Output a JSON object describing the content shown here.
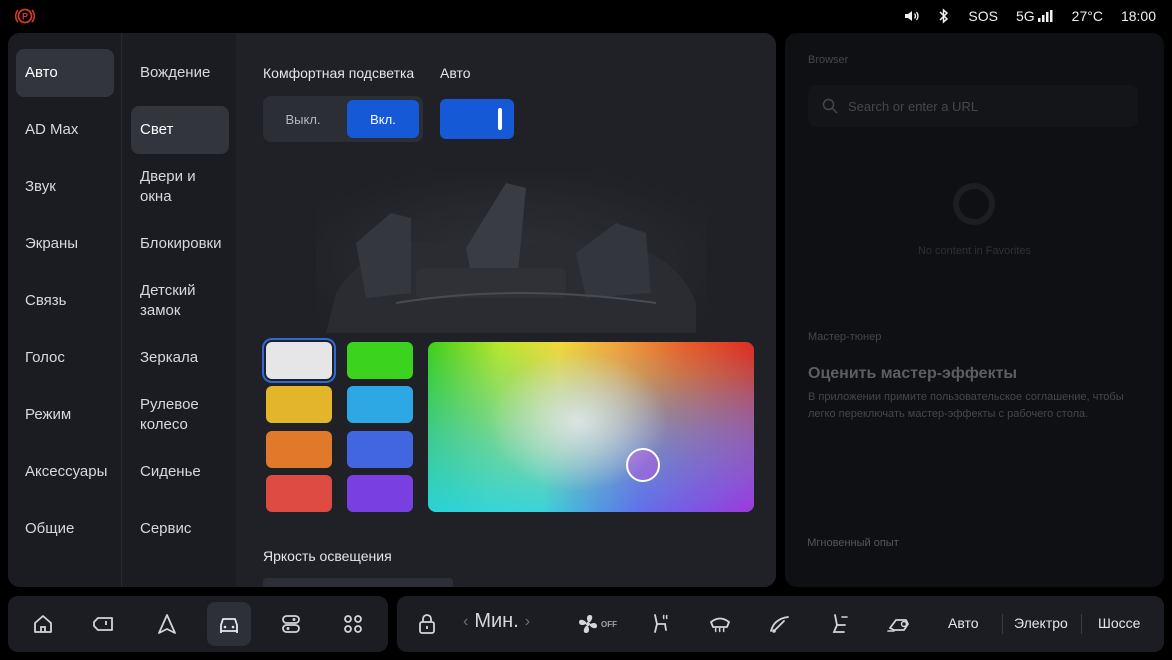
{
  "status_bar": {
    "sos": "SOS",
    "network": "5G",
    "temperature": "27°C",
    "time": "18:00"
  },
  "left_nav": [
    "Авто",
    "AD Max",
    "Звук",
    "Экраны",
    "Связь",
    "Голос",
    "Режим",
    "Аксессуары",
    "Общие"
  ],
  "left_nav_active": "Авто",
  "sub_nav": [
    "Вождение",
    "Свет",
    "Двери и окна",
    "Блокировки",
    "Детский замок",
    "Зеркала",
    "Рулевое колесо",
    "Сиденье",
    "Сервис"
  ],
  "sub_nav_active": "Свет",
  "content": {
    "comfort_light_label": "Комфортная подсветка",
    "auto_label": "Авто",
    "off_label": "Выкл.",
    "on_label": "Вкл.",
    "auto_toggle_on": true,
    "brightness_label": "Яркость освещения",
    "swatches": [
      "#e6e6e8",
      "#3cd31f",
      "#e3b52a",
      "#2ea8e4",
      "#e07a2a",
      "#4266e0",
      "#de4b42",
      "#7a3fe0"
    ],
    "selected_swatch": 0
  },
  "side_panel": {
    "browser_label": "Browser",
    "url_placeholder": "Search or enter a URL",
    "no_content": "No content in Favorites",
    "master_label": "Мастер-тюнер",
    "master_title": "Оценить мастер-эффекты",
    "master_desc": "В приложении примите пользовательское соглашение, чтобы легко переключать мастер-эффекты с рабочего стола.",
    "instant_label": "Мгновенный опыт"
  },
  "dock": {
    "climate_temp": "Мин.",
    "fan_off": "OFF",
    "modes": [
      "Авто",
      "Электро",
      "Шоссе"
    ]
  },
  "colors": {
    "accent": "#1659d6",
    "panel": "#1d1f24"
  }
}
